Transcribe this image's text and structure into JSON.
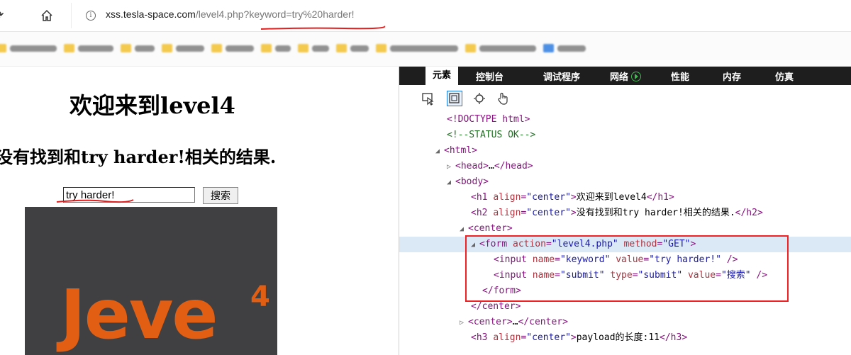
{
  "browser": {
    "url_host": "xss.tesla-space.com",
    "url_path": "/level4.php?keyword=try%20harder!",
    "bookmarks": [
      {
        "kind": "folder",
        "w": 66
      },
      {
        "kind": "folder",
        "w": 50
      },
      {
        "kind": "folder",
        "w": 28
      },
      {
        "kind": "folder",
        "w": 40
      },
      {
        "kind": "folder",
        "w": 40
      },
      {
        "kind": "folder",
        "w": 22
      },
      {
        "kind": "folder",
        "w": 24
      },
      {
        "kind": "folder",
        "w": 26
      },
      {
        "kind": "folder",
        "w": 96
      },
      {
        "kind": "folder",
        "w": 80
      },
      {
        "kind": "blue",
        "w": 40
      }
    ]
  },
  "page": {
    "h1": "欢迎来到level4",
    "h2": "没有找到和try harder!相关的结果.",
    "keyword_value": "try harder!",
    "search_label": "搜索",
    "image_main": "Jeve",
    "image_sup": "4"
  },
  "devtools": {
    "tabs": {
      "elements": "元素",
      "console": "控制台",
      "debugger": "调试程序",
      "network": "网络",
      "performance": "性能",
      "memory": "内存",
      "emulation": "仿真"
    },
    "tools": [
      "select-element-icon",
      "dom-highlight-icon",
      "color-picker-icon",
      "touch-icon"
    ]
  }
}
